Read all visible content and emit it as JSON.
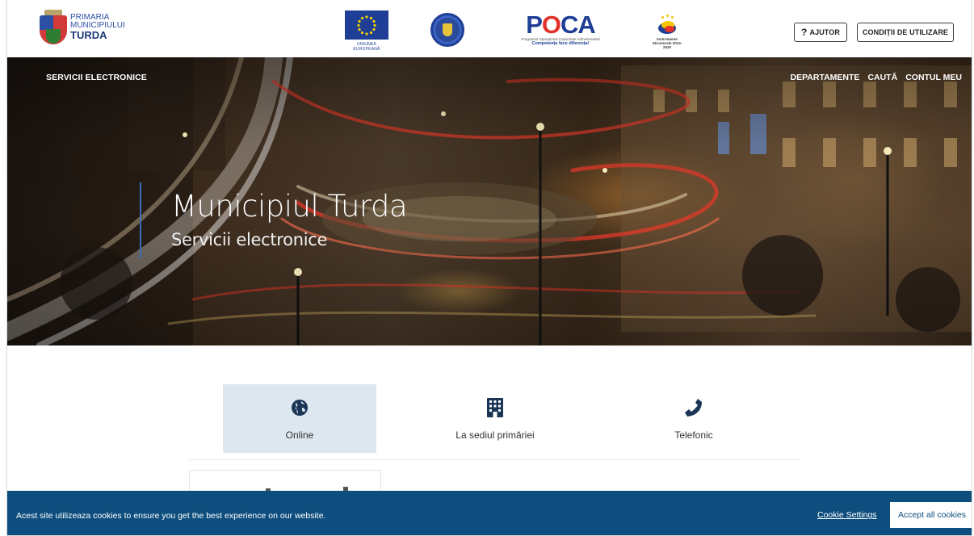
{
  "header": {
    "logo": {
      "line1": "PRIMARIA",
      "line2": "MUNICIPIULUI",
      "line3": "TURDA"
    },
    "partners": {
      "eu_caption": "UNIUNEA EUROPEANĂ",
      "poca_small": "Programul Operațional Capacitate Administrativă",
      "poca_tag": "Competența face diferența!",
      "instr_caption": "Instrumente Structurale 2014-2020"
    },
    "help_label": "AJUTOR",
    "terms_label": "CONDIȚII DE UTILIZARE"
  },
  "nav": {
    "brand": "SERVICII ELECTRONICE",
    "items": [
      "DEPARTAMENTE",
      "CAUTĂ",
      "CONTUL MEU"
    ]
  },
  "hero": {
    "title": "Municipiul Turda",
    "subtitle": "Servicii electronice"
  },
  "tabs": [
    {
      "label": "Online",
      "icon": "globe-icon",
      "active": true
    },
    {
      "label": "La sediul primăriei",
      "icon": "building-icon",
      "active": false
    },
    {
      "label": "Telefonic",
      "icon": "phone-icon",
      "active": false
    }
  ],
  "cookie": {
    "text": "Acest site utilizeaza cookies to ensure you get the best experience on our website.",
    "settings_label": "Cookie Settings",
    "accept_label": "Accept all cookies"
  },
  "colors": {
    "accent": "#0e4e7e",
    "tab_active_bg": "#dde7f0",
    "icon": "#1b3556",
    "hero_rule": "#3a6fb5"
  }
}
